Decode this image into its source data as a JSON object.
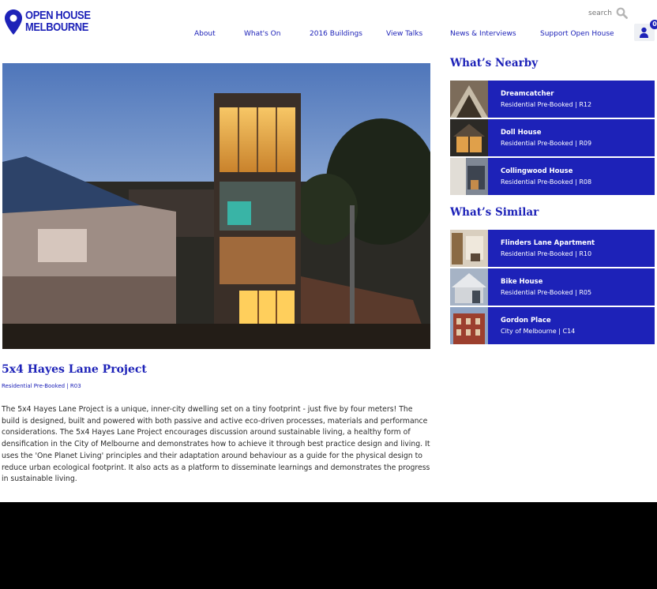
{
  "brand": {
    "line1": "OPEN HOUSE",
    "line2": "MELBOURNE",
    "color": "#1d22b8"
  },
  "search": {
    "placeholder": "search"
  },
  "nav": {
    "items": [
      {
        "label": "About"
      },
      {
        "label": "What's On"
      },
      {
        "label": "2016 Buildings"
      },
      {
        "label": "View Talks"
      },
      {
        "label": "News & Interviews"
      },
      {
        "label": "Support Open House"
      }
    ]
  },
  "cart": {
    "count": "0"
  },
  "project": {
    "title": "5x4 Hayes Lane Project",
    "meta": "Residential Pre-Booked | R03",
    "description": "The 5x4 Hayes Lane Project is a unique, inner-city dwelling set on a tiny footprint - just five by four meters! The build is designed, built and powered with both passive and active eco-driven processes, materials and performance considerations. The 5x4 Hayes Lane Project encourages discussion around sustainable living, a healthy form of densification in the City of Melbourne and demonstrates how to achieve it through best practice design and living. It uses the 'One Planet Living' principles and their adaptation around behaviour as a guide for the physical design to reduce urban ecological footprint. It also acts as a platform to disseminate learnings and demonstrates the progress in sustainable living."
  },
  "nearby": {
    "title": "What’s Nearby",
    "items": [
      {
        "name": "Dreamcatcher",
        "sub": "Residential Pre-Booked | R12"
      },
      {
        "name": "Doll House",
        "sub": "Residential Pre-Booked | R09"
      },
      {
        "name": "Collingwood House",
        "sub": "Residential Pre-Booked | R08"
      }
    ]
  },
  "similar": {
    "title": "What’s Similar",
    "items": [
      {
        "name": "Flinders Lane Apartment",
        "sub": "Residential Pre-Booked | R10"
      },
      {
        "name": "Bike House",
        "sub": "Residential Pre-Booked | R05"
      },
      {
        "name": "Gordon Place",
        "sub": "City of Melbourne | C14"
      }
    ]
  }
}
